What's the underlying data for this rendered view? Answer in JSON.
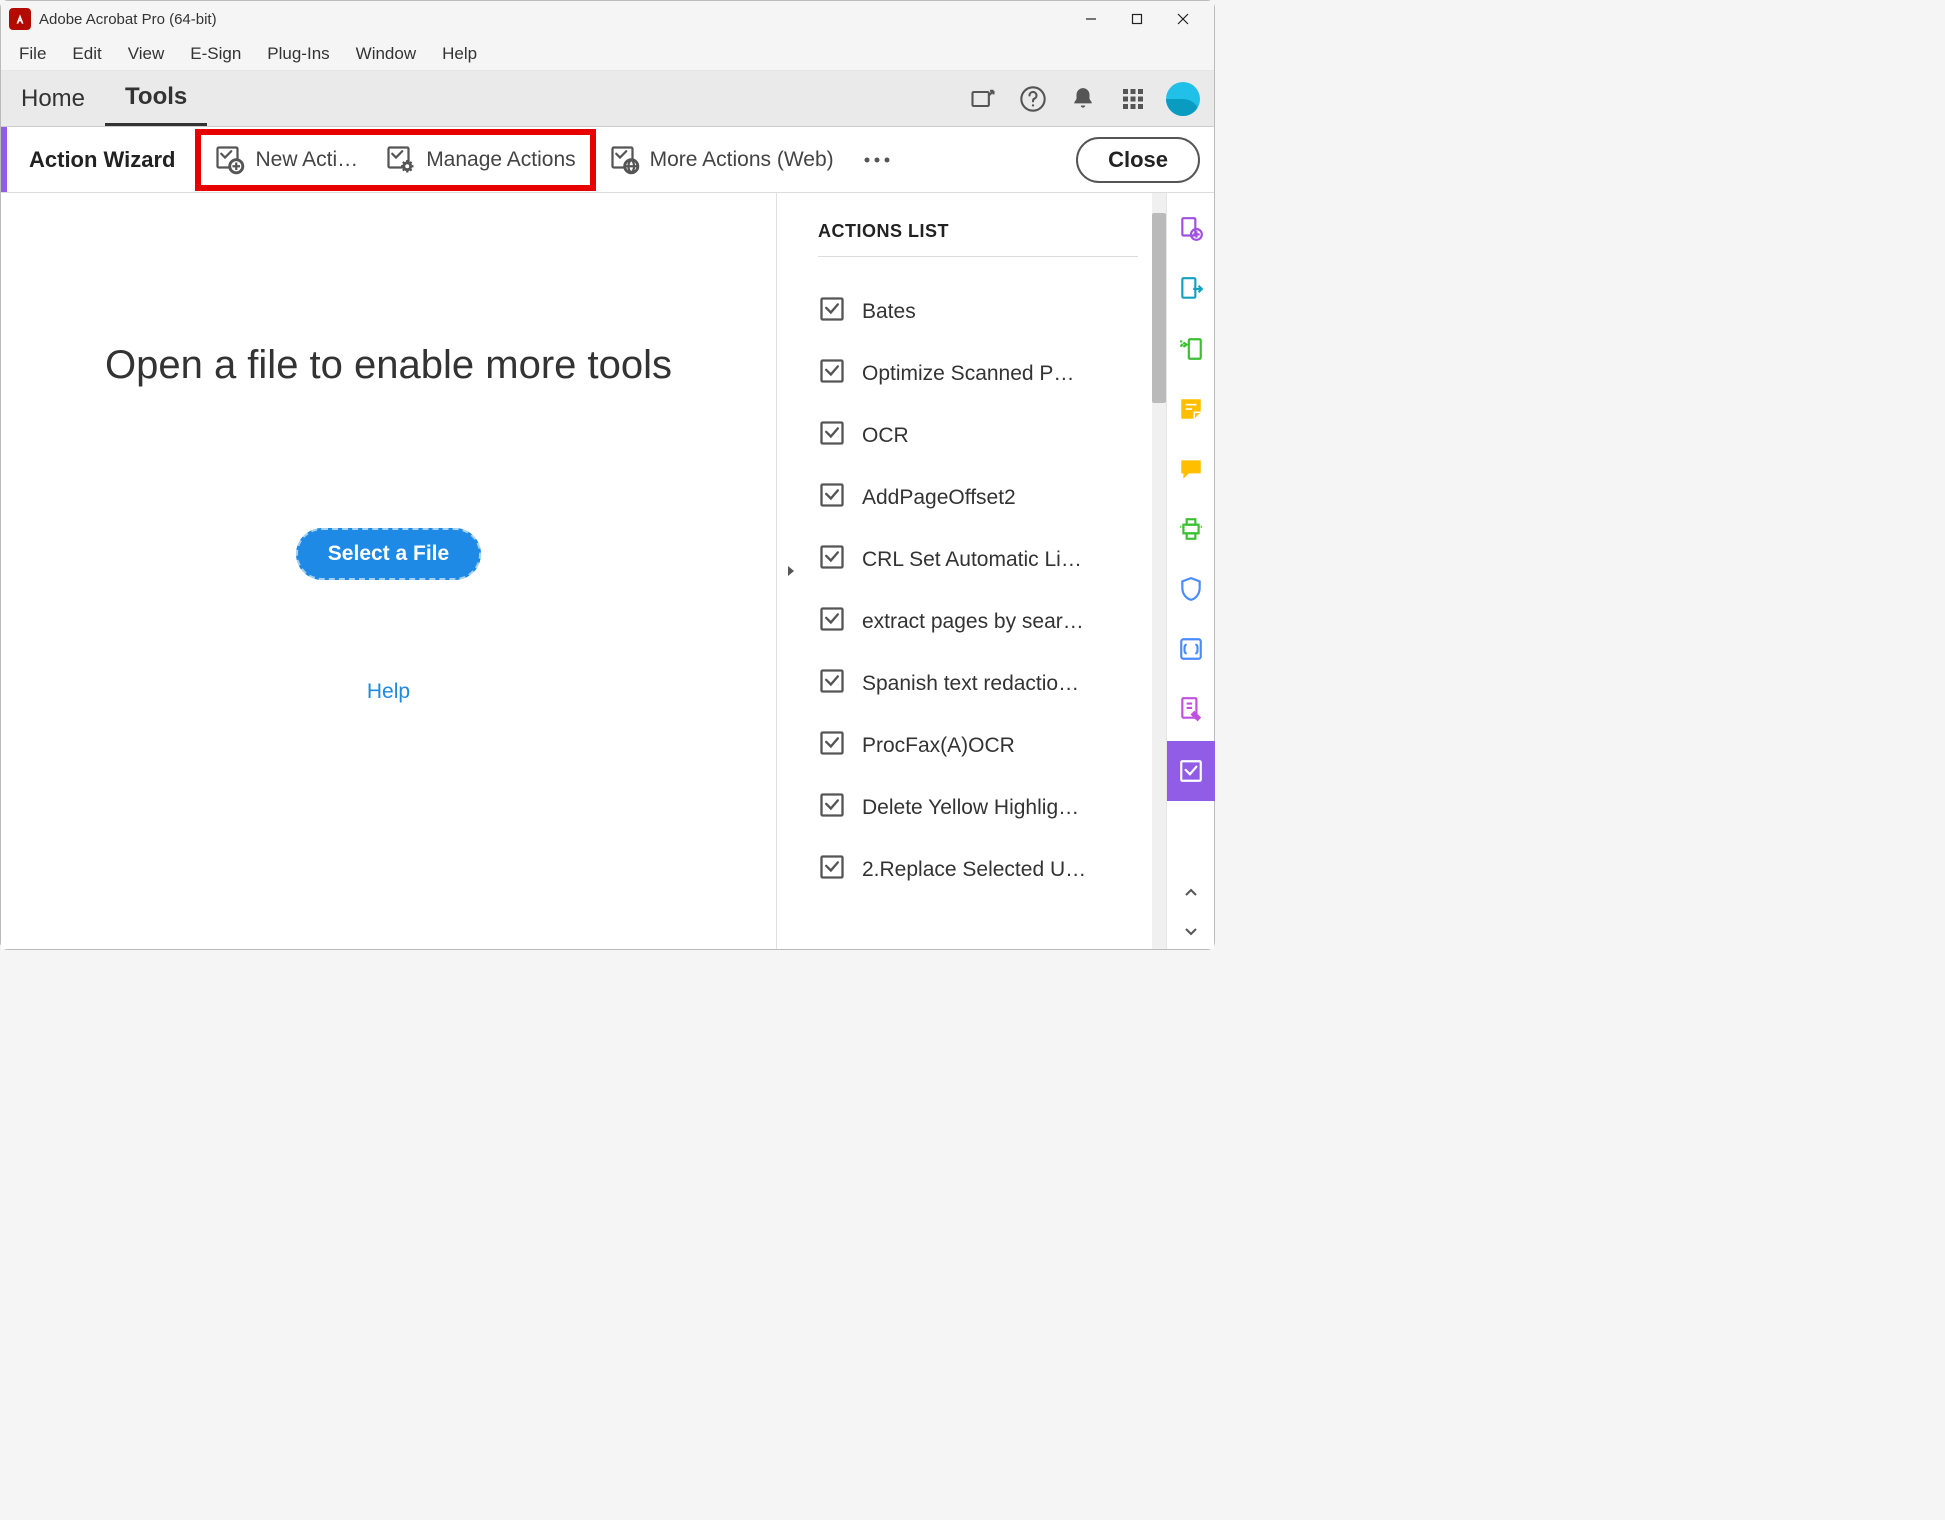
{
  "window": {
    "title": "Adobe Acrobat Pro (64-bit)"
  },
  "menuBar": {
    "items": [
      "File",
      "Edit",
      "View",
      "E-Sign",
      "Plug-Ins",
      "Window",
      "Help"
    ]
  },
  "tabBar": {
    "home": "Home",
    "tools": "Tools",
    "activeTab": "tools",
    "icons": [
      "share-icon",
      "help-icon",
      "bell-icon",
      "grid-icon"
    ]
  },
  "toolbar": {
    "toolName": "Action Wizard",
    "newAction": "New Acti…",
    "manageActions": "Manage Actions",
    "moreActions": "More Actions (Web)",
    "close": "Close"
  },
  "content": {
    "headline": "Open a file to enable more tools",
    "selectFile": "Select a File",
    "help": "Help"
  },
  "sidePanel": {
    "heading": "ACTIONS LIST",
    "actions": [
      "Bates",
      "Optimize Scanned P…",
      "OCR",
      "AddPageOffset2",
      "CRL Set Automatic Li…",
      "extract pages by sear…",
      "Spanish text redactio…",
      "ProcFax(A)OCR",
      "Delete Yellow Highlig…",
      "2.Replace Selected U…"
    ]
  },
  "rightRail": {
    "tools": [
      {
        "name": "create-pdf-icon",
        "color": "#a050e0"
      },
      {
        "name": "export-pdf-icon",
        "color": "#14a0c0"
      },
      {
        "name": "send-to-device-icon",
        "color": "#3ac030"
      },
      {
        "name": "sticky-note-icon",
        "color": "#ffbf00"
      },
      {
        "name": "comment-icon",
        "color": "#ffbf00"
      },
      {
        "name": "print-production-icon",
        "color": "#3ac030"
      },
      {
        "name": "protect-icon",
        "color": "#4a8cff"
      },
      {
        "name": "javascript-icon",
        "color": "#4a8cff"
      },
      {
        "name": "edit-pdf-icon",
        "color": "#c050e0"
      }
    ],
    "activeTool": {
      "name": "action-wizard-icon"
    }
  }
}
